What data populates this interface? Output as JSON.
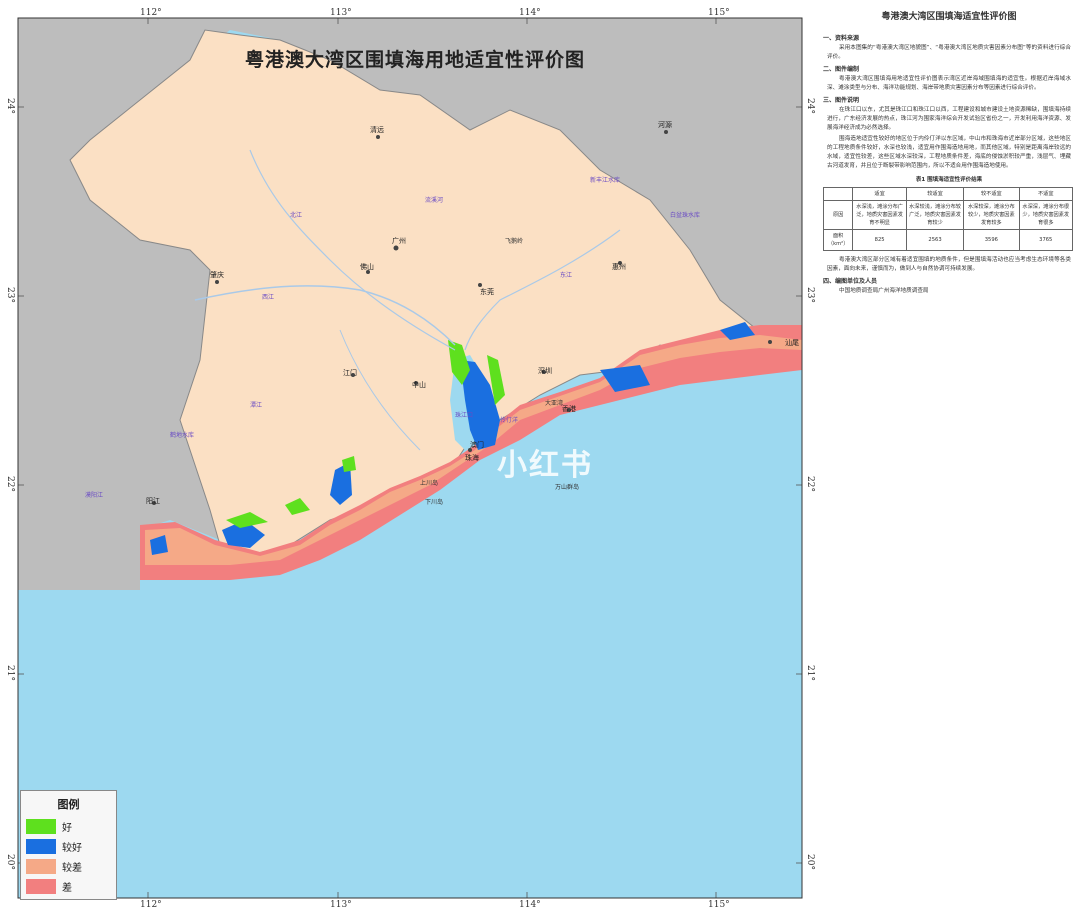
{
  "map": {
    "title": "粤港澳大湾区围填海用地适宜性评价图",
    "watermark": "小红书",
    "lon_ticks": [
      "112°",
      "113°",
      "114°",
      "115°"
    ],
    "lat_ticks": [
      "24°",
      "23°",
      "22°",
      "21°",
      "20°"
    ],
    "cities": [
      "清远",
      "河源",
      "广州",
      "肇庆",
      "佛山",
      "东莞",
      "惠州",
      "江门",
      "中山",
      "深圳",
      "香港",
      "澳门",
      "珠海",
      "阳江",
      "汕尾"
    ],
    "places": [
      "飞鹅岭",
      "大亚湾",
      "上川岛",
      "下川岛",
      "万山群岛"
    ],
    "rivers": [
      "北江",
      "西江",
      "东江",
      "新丰江水库",
      "白盆珠水库",
      "流溪河",
      "潭江",
      "鹤地水库",
      "漠阳江",
      "珠江口",
      "伶仃洋"
    ]
  },
  "legend": {
    "title": "图例",
    "items": [
      {
        "label": "好",
        "color": "#5ee01e"
      },
      {
        "label": "较好",
        "color": "#1a6fe0"
      },
      {
        "label": "较差",
        "color": "#f5a987"
      },
      {
        "label": "差",
        "color": "#f27f7f"
      }
    ]
  },
  "colors": {
    "sea": "#9dd9f0",
    "land": "#fbe0c4",
    "outside": "#bdbdbd",
    "boundary": "#888888"
  },
  "panel": {
    "title": "粤港澳大湾区围填海适宜性评价图",
    "sec1": "一、资料来源",
    "p1": "采用本图集的“粤港澳大湾区地貌图”、“粤港澳大湾区地质灾害因素分布图”等的资料进行综合评价。",
    "sec2": "二、图件编制",
    "p2": "粤港澳大湾区围填海用地适宜性评价图表示湾区近岸海域围填海的适宜性。根据近岸海域水深、滩涂类型与分布、海洋功能规划、海岸带地质灾害因素分布等因素进行综合评价。",
    "sec3": "三、图件说明",
    "p3": "在珠江口以东，尤其是珠江口和珠江口以西，工程建设和城市建设土地资源稀缺，围填海持续进行，广东经济发展的热点，珠江河为围家海洋综合开发试验区省份之一，开发利用海洋资源、发展海洋经济成为必然选择。",
    "p4": "围海造地适宜性较好的地区位于内伶仃洋以东区域，中山市和珠海市近岸部分区域，这些地区的工程地质条件较好，水深也较浅，适宜用作围海造地用地，而其他区域，特别是距离海岸较远的水域，适宜性较差，这些区域水深较深，工程地质条件差，海底的侵蚀淤积较严重，浅层气、埋藏古河道发育，并且位于断裂带影响范围内，所以不适合用作围海造地使用。",
    "table_caption": "表1 围填海适宜性评价结果",
    "table_headers": [
      "",
      "适宜",
      "较适宜",
      "较不适宜",
      "不适宜"
    ],
    "row1_label": "原因",
    "row1": [
      "水深浅，滩涂分布广泛，地质灾害因素发育不明显",
      "水深较浅，滩涂分布较广泛，地质灾害因素发育较少",
      "水深较深，滩涂分布较少，地质灾害因素发育较多",
      "水深深，滩涂分布很少，地质灾害因素发育很多"
    ],
    "row2_label": "面积（km²）",
    "row2": [
      "825",
      "2563",
      "3596",
      "3765"
    ],
    "p5": "粤港澳大湾区部分区域有着适宜围填的地质条件，但是围填海活动也应当考虑生态环境等各类因素，面向未来，谨慎而为，做到人与自然协调可持续发展。",
    "sec4": "四、编图单位及人员",
    "p6": "中国地质调查局广州海洋地质调查局"
  }
}
